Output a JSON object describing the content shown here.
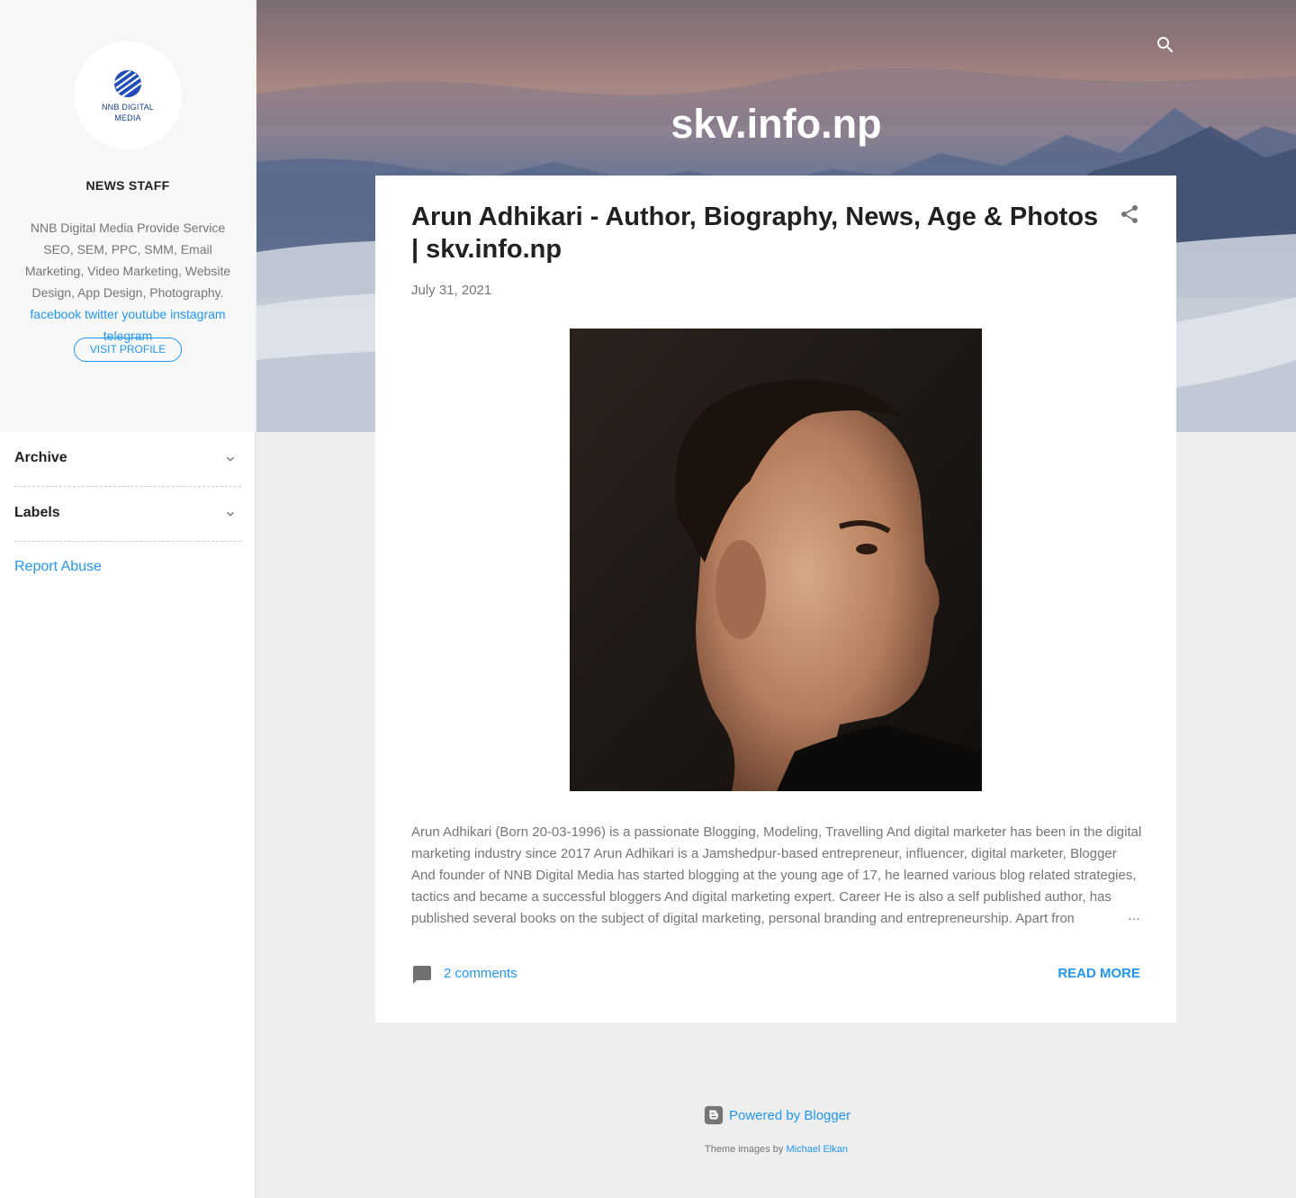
{
  "sidebar": {
    "logo_text_line1": "NNB DIGITAL",
    "logo_text_line2": "MEDIA",
    "profile_name": "NEWS STAFF",
    "profile_description": "NNB Digital Media Provide Service SEO, SEM, PPC, SMM, Email Marketing, Video Marketing, Website Design, App Design, Photography.",
    "social_links": [
      "facebook",
      "twitter",
      "youtube",
      "instagram",
      "telegram"
    ],
    "visit_profile_label": "VISIT PROFILE",
    "widgets": [
      {
        "title": "Archive",
        "icon": "chevron-down-icon"
      },
      {
        "title": "Labels",
        "icon": "chevron-down-icon"
      }
    ],
    "report_abuse_label": "Report Abuse"
  },
  "header": {
    "site_title": "skv.info.np",
    "search_icon": "search-icon"
  },
  "post": {
    "title": "Arun Adhikari - Author, Biography, News, Age & Photos | skv.info.np",
    "date": "July 31, 2021",
    "share_icon": "share-icon",
    "image_alt": "Arun Adhikari portrait",
    "snippet": "Arun Adhikari (Born 20-03-1996) is a passionate Blogging, Modeling, Travelling And digital marketer has been in the digital marketing industry since 2017 Arun Adhikari is a Jamshedpur-based entrepreneur, influencer, digital marketer, Blogger And founder of NNB Digital Media has started blogging at the young age of 17, he learned various blog related strategies, tactics and became a successful bloggers And digital marketing expert. Career He is also a self published author, has published several books on the subject of digital marketing, personal branding and entrepreneurship. Apart from",
    "ellipsis": "…",
    "comments_label": "2 comments",
    "read_more_label": "READ MORE"
  },
  "footer": {
    "powered_by_label": "Powered by Blogger",
    "theme_credit_prefix": "Theme images by",
    "theme_credit_author": "Michael Elkan"
  },
  "colors": {
    "accent": "#2196f3",
    "text_primary": "#212121",
    "text_secondary": "#757575",
    "page_background": "#eeeeee",
    "sidebar_profile_background": "#f7f7f7"
  }
}
